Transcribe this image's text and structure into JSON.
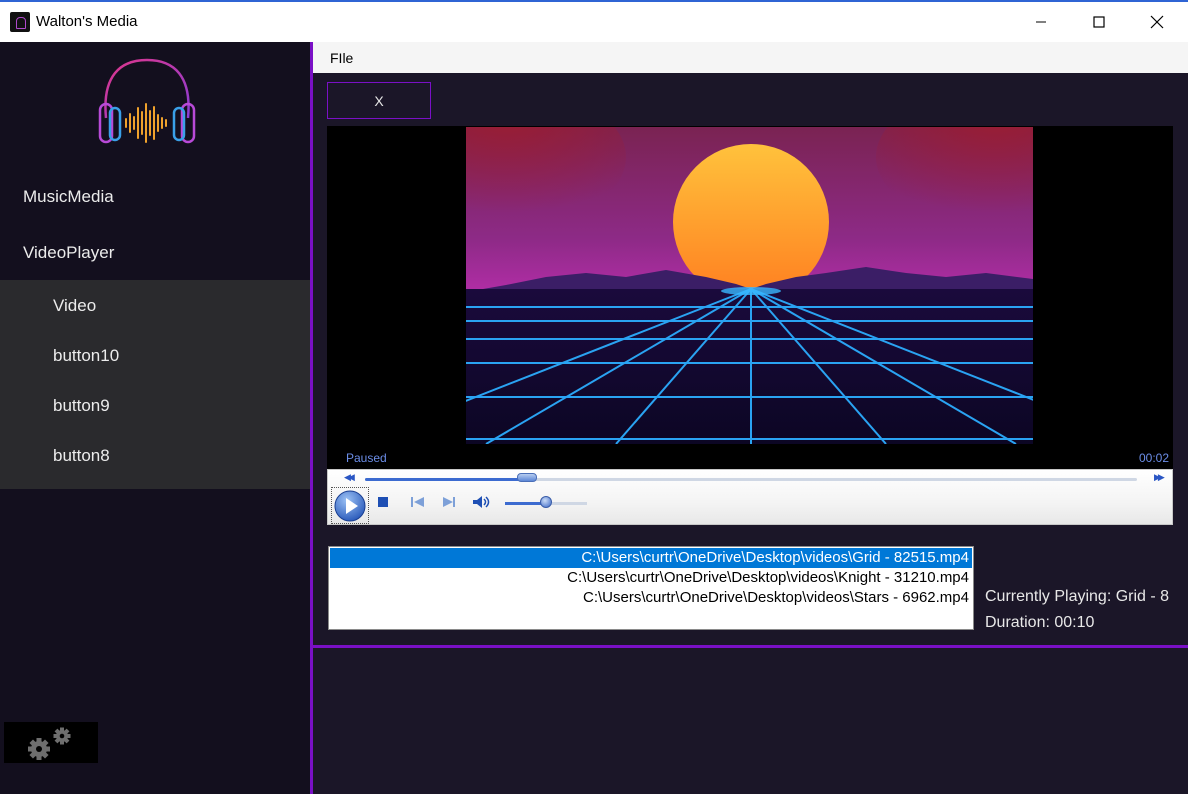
{
  "window": {
    "title": "Walton's Media"
  },
  "menu": {
    "file": "FIle"
  },
  "sidebar": {
    "items": [
      {
        "label": "MusicMedia"
      },
      {
        "label": "VideoPlayer"
      }
    ],
    "submenu": [
      {
        "label": "Video"
      },
      {
        "label": "button10"
      },
      {
        "label": "button9"
      },
      {
        "label": "button8"
      }
    ]
  },
  "close_button": {
    "label": "X"
  },
  "player": {
    "status": "Paused",
    "time": "00:02",
    "seek_progress": 0.21,
    "volume_level": 0.5
  },
  "playlist": {
    "items": [
      "C:\\Users\\curtr\\OneDrive\\Desktop\\videos\\Grid - 82515.mp4",
      "C:\\Users\\curtr\\OneDrive\\Desktop\\videos\\Knight - 31210.mp4",
      "C:\\Users\\curtr\\OneDrive\\Desktop\\videos\\Stars - 6962.mp4"
    ],
    "selected_index": 0
  },
  "info": {
    "currently_playing": "Currently Playing: Grid - 8",
    "duration": "Duration: 00:10"
  },
  "colors": {
    "accent": "#7a10c6",
    "sidebar_bg": "#130f1e",
    "submenu_bg": "#2a2a2d",
    "selection": "#0078d7"
  },
  "icons": [
    "app-icon",
    "minimize-icon",
    "maximize-icon",
    "close-icon",
    "headphones-logo",
    "play-icon",
    "stop-icon",
    "previous-icon",
    "next-icon",
    "volume-icon",
    "rewind-icon",
    "fast-forward-icon",
    "gears-icon"
  ]
}
